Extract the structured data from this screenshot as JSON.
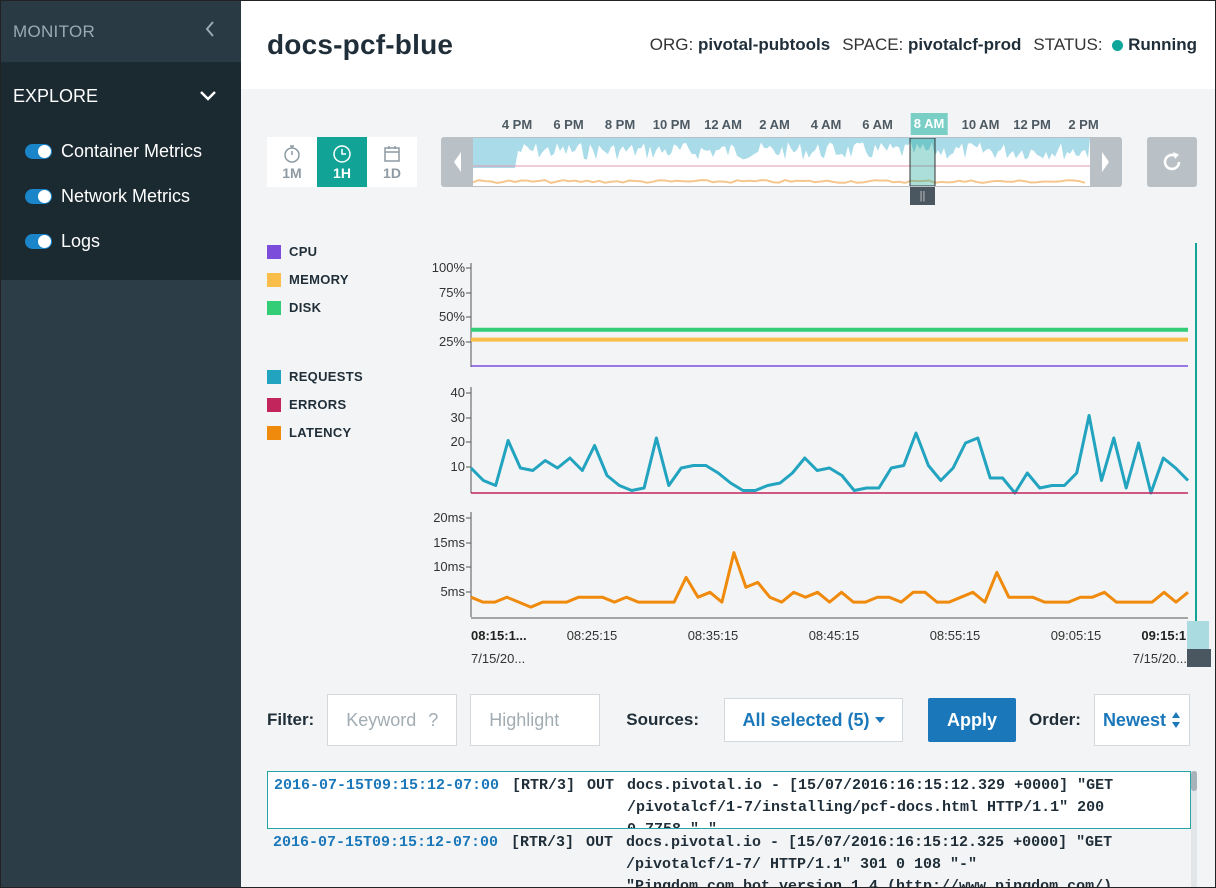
{
  "sidebar": {
    "monitor_label": "MONITOR",
    "explore_label": "EXPLORE",
    "items": [
      {
        "label": "Container Metrics",
        "enabled": true
      },
      {
        "label": "Network Metrics",
        "enabled": true
      },
      {
        "label": "Logs",
        "enabled": true
      }
    ]
  },
  "header": {
    "app_name": "docs-pcf-blue",
    "org_label": "ORG:",
    "org_value": "pivotal-pubtools",
    "space_label": "SPACE:",
    "space_value": "pivotalcf-prod",
    "status_label": "STATUS:",
    "status_value": "Running",
    "status_color": "#0fa59b"
  },
  "range_buttons": [
    {
      "label": "1M",
      "icon": "stopwatch-icon",
      "active": false
    },
    {
      "label": "1H",
      "icon": "clock-icon",
      "active": true
    },
    {
      "label": "1D",
      "icon": "calendar-icon",
      "active": false
    }
  ],
  "timeline": {
    "labels": [
      "4 PM",
      "6 PM",
      "8 PM",
      "10 PM",
      "12 AM",
      "2 AM",
      "4 AM",
      "6 AM",
      "8 AM",
      "10 AM",
      "12 PM",
      "2 PM"
    ],
    "selected_label": "8 AM",
    "handle_label": "||"
  },
  "legend": {
    "container": [
      {
        "label": "CPU",
        "color": "#7c4ddb"
      },
      {
        "label": "MEMORY",
        "color": "#f9bd4a"
      },
      {
        "label": "DISK",
        "color": "#33cc77"
      }
    ],
    "network": [
      {
        "label": "REQUESTS",
        "color": "#22a3bf"
      },
      {
        "label": "ERRORS",
        "color": "#c2255c"
      },
      {
        "label": "LATENCY",
        "color": "#f08a0c"
      }
    ]
  },
  "chart_data": [
    {
      "type": "line",
      "title": "",
      "ylabel": "",
      "ylim": [
        0,
        100
      ],
      "yticks": [
        "100%",
        "75%",
        "50%",
        "25%"
      ],
      "series": [
        {
          "name": "CPU",
          "color": "#7c4ddb",
          "values": [
            1,
            1
          ]
        },
        {
          "name": "MEMORY",
          "color": "#f9bd4a",
          "values": [
            28,
            28
          ]
        },
        {
          "name": "DISK",
          "color": "#33cc77",
          "values": [
            38,
            38
          ]
        }
      ]
    },
    {
      "type": "line",
      "title": "",
      "ylabel": "",
      "ylim": [
        0,
        40
      ],
      "yticks": [
        "40",
        "30",
        "20",
        "10"
      ],
      "series": [
        {
          "name": "REQUESTS",
          "color": "#22a3bf",
          "values": [
            10,
            5,
            3,
            21,
            10,
            9,
            13,
            10,
            14,
            9,
            19,
            7,
            3,
            1,
            2,
            22,
            3,
            10,
            11,
            11,
            8,
            4,
            1,
            1,
            3,
            4,
            8,
            14,
            9,
            10,
            7,
            1,
            2,
            2,
            10,
            11,
            24,
            11,
            5,
            10,
            20,
            22,
            6,
            6,
            0,
            8,
            2,
            3,
            3,
            8,
            31,
            5,
            22,
            2,
            20,
            0,
            14,
            10,
            5
          ]
        },
        {
          "name": "ERRORS",
          "color": "#c2255c",
          "values": [
            0,
            0
          ]
        }
      ]
    },
    {
      "type": "line",
      "title": "",
      "ylabel": "",
      "ylim": [
        0,
        20
      ],
      "yticks": [
        "20ms",
        "15ms",
        "10ms",
        "5ms"
      ],
      "x_ticks": [
        "08:15:1...",
        "08:25:15",
        "08:35:15",
        "08:45:15",
        "08:55:15",
        "09:05:15",
        "09:15:1..."
      ],
      "x_sublabels": [
        "7/15/20...",
        "7/15/20..."
      ],
      "series": [
        {
          "name": "LATENCY",
          "color": "#f08a0c",
          "values": [
            4,
            3,
            3,
            4,
            3,
            2,
            3,
            3,
            3,
            4,
            4,
            4,
            3,
            4,
            3,
            3,
            3,
            3,
            8,
            4,
            5,
            3,
            13,
            6,
            7,
            4,
            3,
            5,
            4,
            5,
            3,
            5,
            3,
            3,
            4,
            4,
            3,
            5,
            5,
            3,
            3,
            4,
            5,
            3,
            9,
            4,
            4,
            4,
            3,
            3,
            3,
            4,
            4,
            5,
            3,
            3,
            3,
            3,
            5,
            3,
            5
          ]
        }
      ]
    }
  ],
  "filter": {
    "filter_label": "Filter:",
    "keyword_placeholder": "Keyword",
    "help_mark": "?",
    "highlight_placeholder": "Highlight",
    "sources_label": "Sources:",
    "sources_value": "All selected (5)",
    "apply_label": "Apply",
    "order_label": "Order:",
    "order_value": "Newest"
  },
  "logs": [
    {
      "timestamp": "2016-07-15T09:15:12-07:00",
      "source": "[RTR/3]",
      "direction": "OUT",
      "message": "docs.pivotal.io - [15/07/2016:16:15:12.329 +0000] \"GET\n/pivotalcf/1-7/installing/pcf-docs.html HTTP/1.1\" 200\n0 7758 \"-\"",
      "selected": true
    },
    {
      "timestamp": "2016-07-15T09:15:12-07:00",
      "source": "[RTR/3]",
      "direction": "OUT",
      "message": "docs.pivotal.io - [15/07/2016:16:15:12.325 +0000] \"GET\n/pivotalcf/1-7/ HTTP/1.1\" 301 0 108 \"-\"\n\"Pingdom.com_bot_version_1.4_(http://www.pingdom.com/)",
      "selected": false
    }
  ]
}
